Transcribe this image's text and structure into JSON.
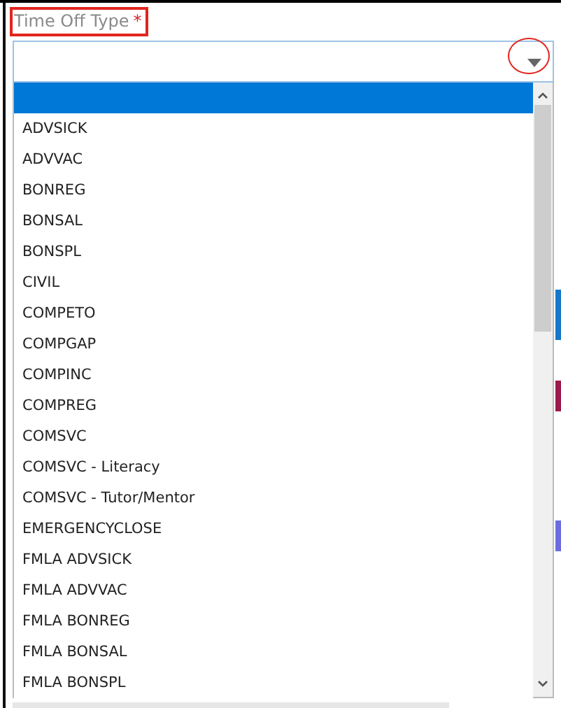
{
  "field": {
    "label": "Time Off Type",
    "required_mark": "*"
  },
  "options": [
    {
      "selected": true
    },
    {
      "label": "ADVSICK",
      "selected": false
    },
    {
      "label": "ADVVAC",
      "selected": false
    },
    {
      "label": "BONREG",
      "selected": false
    },
    {
      "label": "BONSAL",
      "selected": false
    },
    {
      "label": "BONSPL",
      "selected": false
    },
    {
      "label": "CIVIL",
      "selected": false
    },
    {
      "label": "COMPETO",
      "selected": false
    },
    {
      "label": "COMPGAP",
      "selected": false
    },
    {
      "label": "COMPINC",
      "selected": false
    },
    {
      "label": "COMPREG",
      "selected": false
    },
    {
      "label": "COMSVC",
      "selected": false
    },
    {
      "label": "COMSVC - Literacy",
      "selected": false
    },
    {
      "label": "COMSVC - Tutor/Mentor",
      "selected": false
    },
    {
      "label": "EMERGENCYCLOSE",
      "selected": false
    },
    {
      "label": "FMLA ADVSICK",
      "selected": false
    },
    {
      "label": "FMLA ADVVAC",
      "selected": false
    },
    {
      "label": "FMLA BONREG",
      "selected": false
    },
    {
      "label": "FMLA BONSAL",
      "selected": false
    },
    {
      "label": "FMLA BONSPL",
      "selected": false
    }
  ]
}
